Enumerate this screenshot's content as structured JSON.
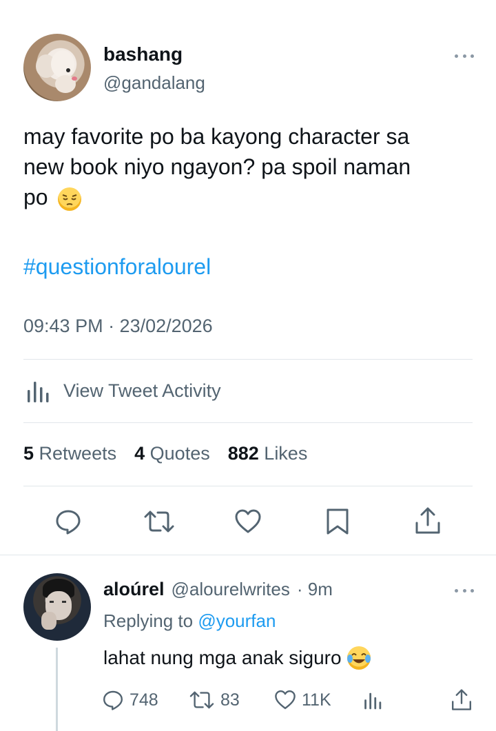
{
  "tweet": {
    "author_name": "bashang",
    "author_handle": "@gandalang",
    "text_line1": "may favorite po ba kayong character sa",
    "text_line2": "new book niyo ngayon? pa spoil naman",
    "text_line3": "po",
    "text_emoji": "pensive-face",
    "hashtag": "#questionforalourel",
    "timestamp": "09:43 PM · 23/02/2026",
    "activity_label": "View Tweet Activity",
    "stats": {
      "retweets_count": "5",
      "retweets_label": "Retweets",
      "quotes_count": "4",
      "quotes_label": "Quotes",
      "likes_count": "882",
      "likes_label": "Likes"
    },
    "actions": [
      "reply-icon",
      "retweet-icon",
      "like-icon",
      "bookmark-icon",
      "share-icon"
    ]
  },
  "reply": {
    "author_name": "aloúrel",
    "author_handle": "@alourelwrites",
    "time": "· 9m",
    "replying_prefix": "Replying to",
    "replying_to": "@yourfan",
    "text": "lahat nung mga anak siguro",
    "text_emoji": "face-with-tears-of-joy",
    "reply_count": "748",
    "retweet_count": "83",
    "like_count": "11K"
  },
  "colors": {
    "accent": "#1d9bf0",
    "secondary_text": "#536471",
    "primary_text": "#0f1419",
    "divider": "#e1e6ea"
  }
}
